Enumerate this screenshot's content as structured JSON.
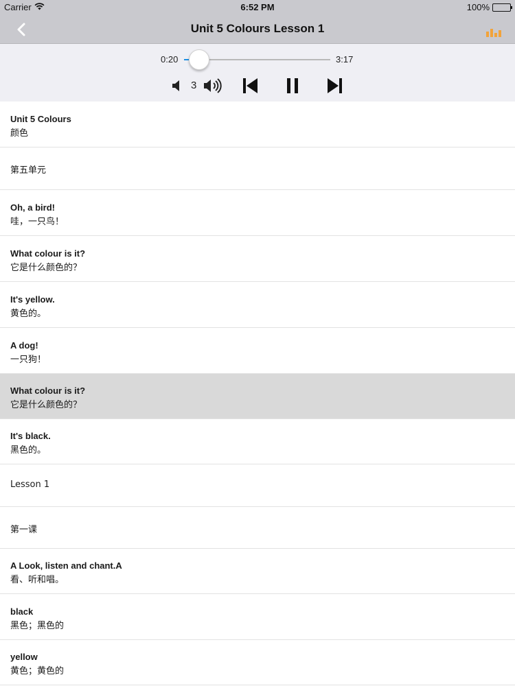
{
  "status_bar": {
    "carrier": "Carrier",
    "time": "6:52 PM",
    "battery": "100%"
  },
  "nav": {
    "title": "Unit 5 Colours Lesson 1",
    "accent_color": "#f2a33a"
  },
  "player": {
    "current_time": "0:20",
    "total_time": "3:17",
    "progress": 0.105,
    "volume": "3",
    "progress_color": "#1a8fe3"
  },
  "items": [
    {
      "type": "pair",
      "en": "Unit 5 Colours",
      "zh": "颜色"
    },
    {
      "type": "single",
      "text": "第五单元"
    },
    {
      "type": "pair",
      "en": "Oh, a bird!",
      "zh": "哇，一只鸟！"
    },
    {
      "type": "pair",
      "en": "What colour is it?",
      "zh": "它是什么颜色的？"
    },
    {
      "type": "pair",
      "en": "It's yellow.",
      "zh": "黄色的。"
    },
    {
      "type": "pair",
      "en": "A dog!",
      "zh": "一只狗！"
    },
    {
      "type": "pair",
      "en": "What colour is it?",
      "zh": "它是什么颜色的？",
      "selected": true
    },
    {
      "type": "pair",
      "en": "It's black.",
      "zh": "黑色的。"
    },
    {
      "type": "single",
      "text": "Lesson 1"
    },
    {
      "type": "single",
      "text": "第一课"
    },
    {
      "type": "pair",
      "en": "A Look, listen and chant.A",
      "zh": "看、听和唱。"
    },
    {
      "type": "pair",
      "en": "black",
      "zh": "黑色；黑色的"
    },
    {
      "type": "pair",
      "en": "yellow",
      "zh": "黄色；黄色的"
    }
  ]
}
